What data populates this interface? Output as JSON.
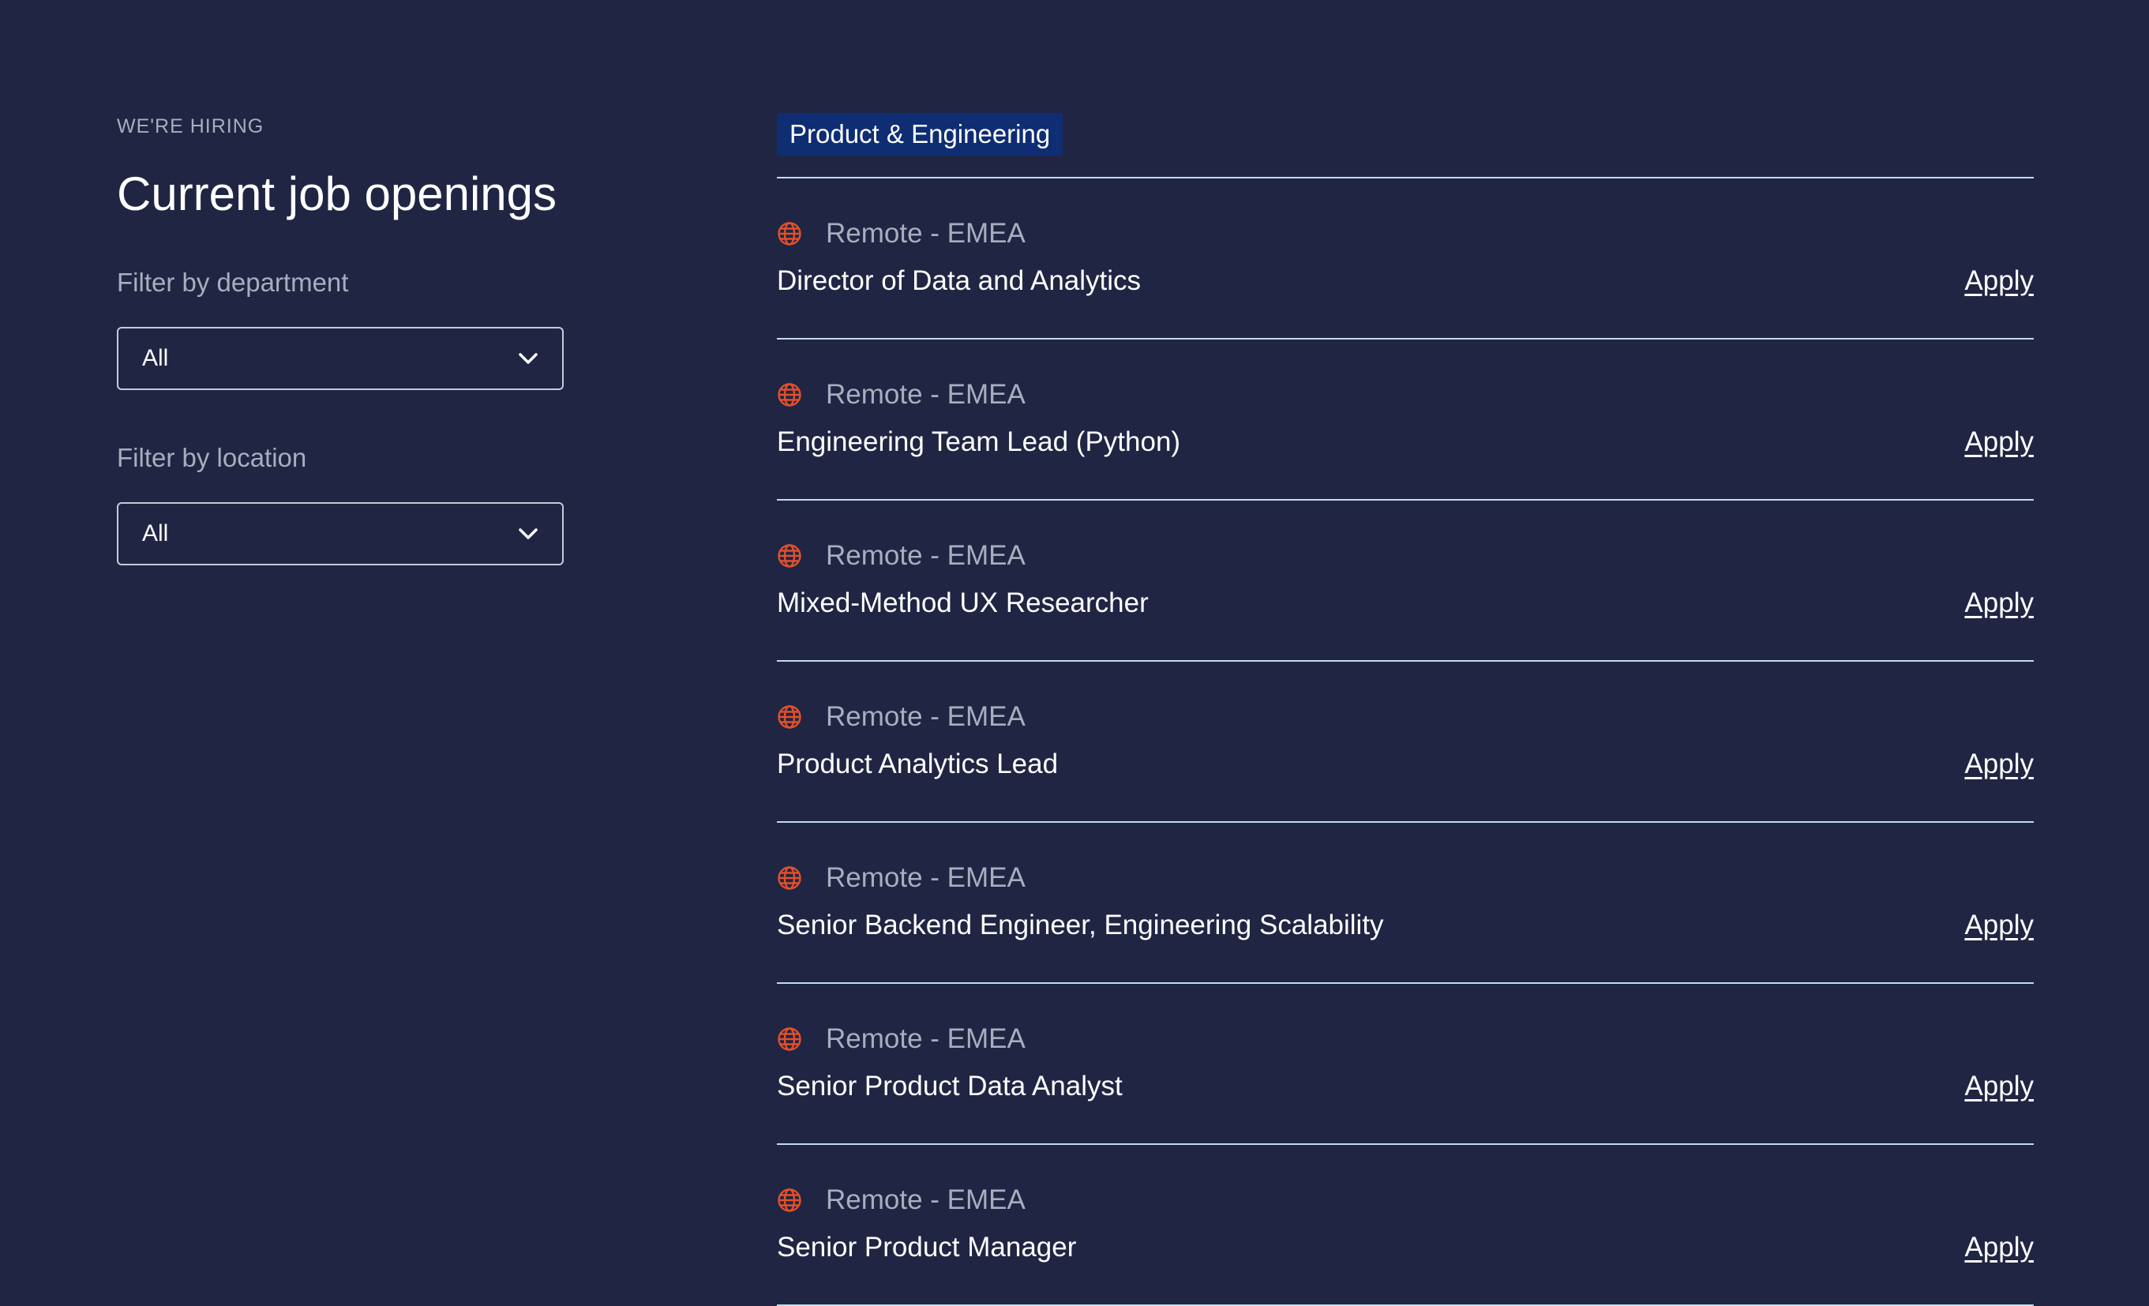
{
  "header": {
    "eyebrow": "WE'RE HIRING",
    "title": "Current job openings"
  },
  "filters": {
    "department": {
      "label": "Filter by department",
      "value": "All"
    },
    "location": {
      "label": "Filter by location",
      "value": "All"
    }
  },
  "department_group": {
    "name": "Product & Engineering",
    "badge_color": "#0f2d73",
    "icon_color": "#e2502b"
  },
  "jobs": [
    {
      "location": "Remote - EMEA",
      "title": "Director of Data and Analytics",
      "apply_label": "Apply"
    },
    {
      "location": "Remote - EMEA",
      "title": "Engineering Team Lead (Python)",
      "apply_label": "Apply"
    },
    {
      "location": "Remote - EMEA",
      "title": "Mixed-Method UX Researcher",
      "apply_label": "Apply"
    },
    {
      "location": "Remote - EMEA",
      "title": "Product Analytics Lead",
      "apply_label": "Apply"
    },
    {
      "location": "Remote - EMEA",
      "title": "Senior Backend Engineer, Engineering Scalability",
      "apply_label": "Apply"
    },
    {
      "location": "Remote - EMEA",
      "title": "Senior Product Data Analyst",
      "apply_label": "Apply"
    },
    {
      "location": "Remote - EMEA",
      "title": "Senior Product Manager",
      "apply_label": "Apply"
    }
  ],
  "icons": {
    "location_icon": "globe-icon",
    "select_icon": "chevron-down-icon"
  }
}
